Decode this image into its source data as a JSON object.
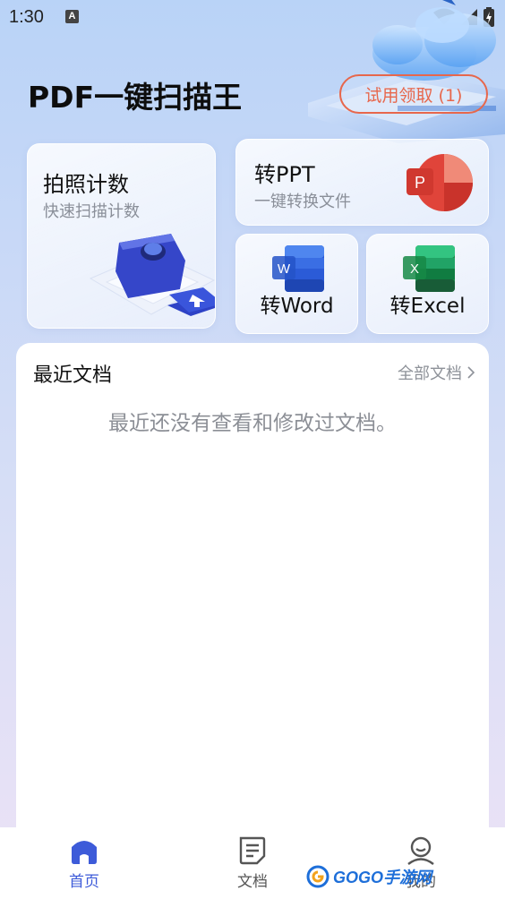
{
  "status": {
    "time": "1:30",
    "a_badge": "A"
  },
  "header": {
    "title": "PDF一键扫描王",
    "trial_label": "试用领取 (1)"
  },
  "cards": {
    "photo": {
      "title": "拍照计数",
      "subtitle": "快速扫描计数"
    },
    "ppt": {
      "title": "转PPT",
      "subtitle": "一键转换文件",
      "icon_letter": "P"
    },
    "word": {
      "label": "转Word",
      "icon_letter": "W"
    },
    "excel": {
      "label": "转Excel",
      "icon_letter": "X"
    }
  },
  "recent": {
    "title": "最近文档",
    "all_label": "全部文档",
    "empty_text": "最近还没有查看和修改过文档。"
  },
  "nav": {
    "home": "首页",
    "docs": "文档",
    "me": "我的"
  },
  "watermark": {
    "text": "GOGO手游网"
  },
  "colors": {
    "accent": "#3d5bd9",
    "trial": "#e7674c",
    "ppt": "#e0443a",
    "word": "#2b5bd7",
    "excel": "#1e8a4c"
  }
}
